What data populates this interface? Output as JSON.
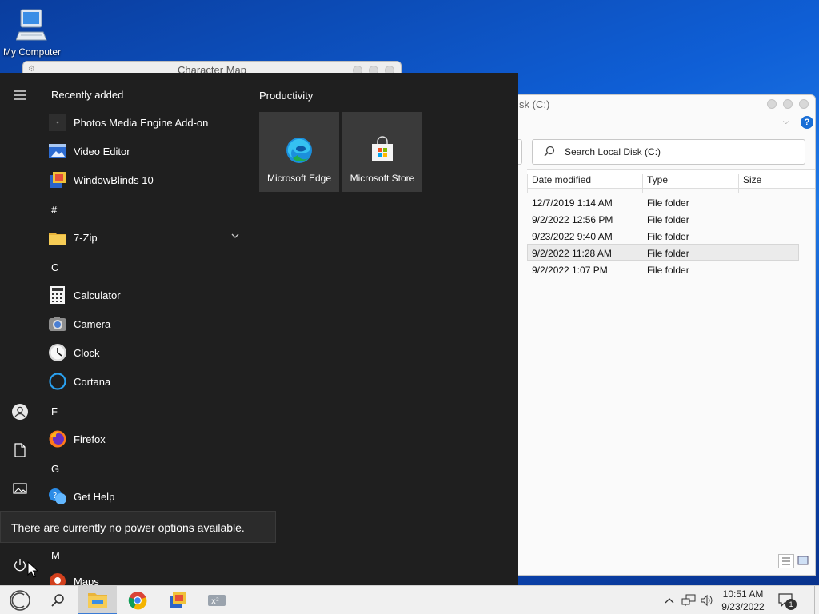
{
  "desktop": {
    "icon_label": "My Computer"
  },
  "charmap": {
    "title": "Character Map"
  },
  "explorer": {
    "title": "sk (C:)",
    "search_placeholder": "Search Local Disk (C:)",
    "columns": [
      "Date modified",
      "Type",
      "Size"
    ],
    "rows": [
      {
        "date": "12/7/2019 1:14 AM",
        "type": "File folder"
      },
      {
        "date": "9/2/2022 12:56 PM",
        "type": "File folder"
      },
      {
        "date": "9/23/2022 9:40 AM",
        "type": "File folder"
      },
      {
        "date": "9/2/2022 11:28 AM",
        "type": "File folder"
      },
      {
        "date": "9/2/2022 1:07 PM",
        "type": "File folder"
      }
    ]
  },
  "start_menu": {
    "recently_added_label": "Recently added",
    "recent_apps": [
      "Photos Media Engine Add-on",
      "Video Editor",
      "WindowBlinds 10"
    ],
    "sections": {
      "hash": "#",
      "c": "C",
      "f": "F",
      "g": "G",
      "m": "M"
    },
    "apps": {
      "zip": "7-Zip",
      "calculator": "Calculator",
      "camera": "Camera",
      "clock": "Clock",
      "cortana": "Cortana",
      "firefox": "Firefox",
      "gethelp": "Get Help",
      "maps": "Maps"
    },
    "tiles_header": "Productivity",
    "tiles": [
      "Microsoft Edge",
      "Microsoft Store"
    ]
  },
  "power_tooltip": "There are currently no power options available.",
  "taskbar": {
    "time": "10:51 AM",
    "date": "9/23/2022",
    "notification_count": "1"
  }
}
